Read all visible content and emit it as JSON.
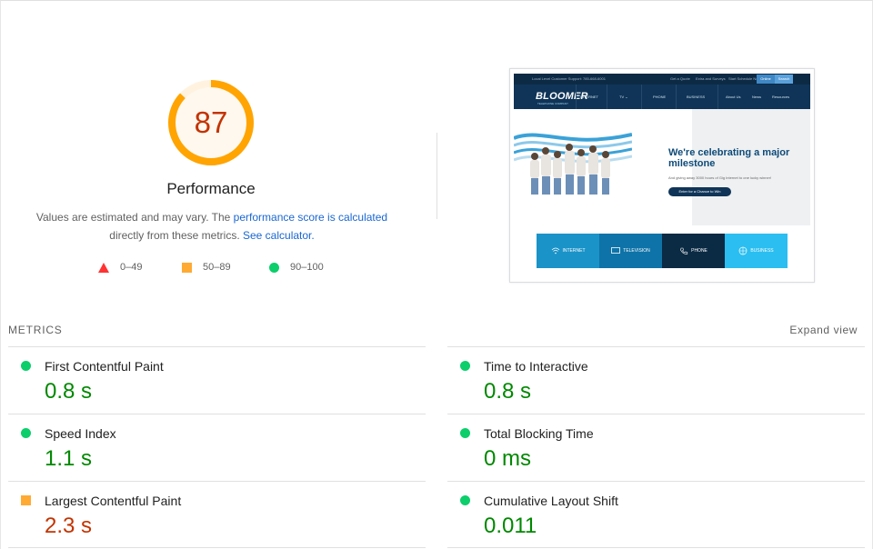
{
  "score": {
    "value": "87",
    "value_fraction": 0.87,
    "ring_color": "#ffa400",
    "title": "Performance"
  },
  "disclaimer": {
    "text_before": "Values are estimated and may vary. The ",
    "link1": "performance score is calculated",
    "text_middle": " directly from these metrics.",
    "link2": "See calculator."
  },
  "legend": [
    {
      "shape": "triangle",
      "color": "#ff3333",
      "label": "0–49"
    },
    {
      "shape": "square",
      "color": "#ffaa33",
      "label": "50–89"
    },
    {
      "shape": "circle",
      "color": "#0cce6b",
      "label": "90–100"
    }
  ],
  "thumbnail": {
    "util_text": "Local Level Customer Support: 785-668-6001",
    "util_links": [
      "Get a Quote",
      "Extra and Surveys",
      "Start Schedule Now"
    ],
    "util_btn1": "Online",
    "util_btn2": "Search",
    "logo": "BLOOMER",
    "logo_sub": "TELEPHONE COMPANY",
    "nav": [
      "INTERNET",
      "TV ⌄",
      "PHONE",
      "BUSINESS",
      "About Us",
      "News",
      "Resources"
    ],
    "headline": "We're celebrating a major milestone",
    "subtext": "And giving away 3000 hours of Gig Internet to one lucky winner!",
    "cta": "Enter for a Chance to Win",
    "tiles": [
      {
        "label": "INTERNET",
        "color": "#1a93c8",
        "icon": "wifi-icon"
      },
      {
        "label": "TELEVISION",
        "color": "#0e73a8",
        "icon": "tv-icon"
      },
      {
        "label": "PHONE",
        "color": "#0b2a44",
        "icon": "phone-icon"
      },
      {
        "label": "BUSINESS",
        "color": "#2bbef0",
        "icon": "globe-icon"
      }
    ]
  },
  "metrics": {
    "header": "METRICS",
    "expand": "Expand view",
    "items": [
      {
        "name": "First Contentful Paint",
        "value": "0.8 s",
        "rating": "good"
      },
      {
        "name": "Time to Interactive",
        "value": "0.8 s",
        "rating": "good"
      },
      {
        "name": "Speed Index",
        "value": "1.1 s",
        "rating": "good"
      },
      {
        "name": "Total Blocking Time",
        "value": "0 ms",
        "rating": "good"
      },
      {
        "name": "Largest Contentful Paint",
        "value": "2.3 s",
        "rating": "average"
      },
      {
        "name": "Cumulative Layout Shift",
        "value": "0.011",
        "rating": "good"
      }
    ]
  }
}
